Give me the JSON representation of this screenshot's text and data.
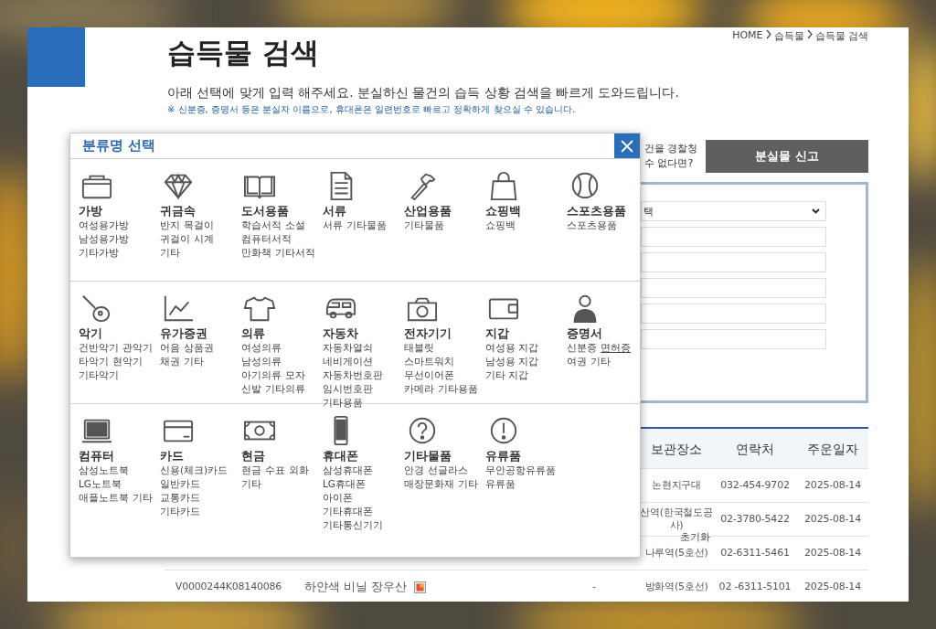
{
  "breadcrumb": [
    "HOME",
    "습득물",
    "습득물 검색"
  ],
  "title": "습득물 검색",
  "description": "아래 선택에 맞게 입력 해주세요. 분실하신 물건의 습득 상황 검색을 빠르게 도와드립니다.",
  "note": "※ 신분증, 증명서 등은 분실자 이름으로, 휴대폰은 일련번호로 빠르고 정확하게 찾으실 수 있습니다.",
  "report": {
    "prompt_lines": [
      "건을 경찰청",
      "수 없다면?"
    ],
    "button": "분실물 신고"
  },
  "search_form": {
    "select_value": "택",
    "reset_label": "초기화"
  },
  "table": {
    "columns": [
      "보관장소",
      "연락처",
      "주운일자"
    ],
    "rows": [
      {
        "location": "논현지구대",
        "phone": "032-454-9702",
        "date": "2025-08-14"
      },
      {
        "location": "산역(한국철도공사)",
        "phone": "02-3780-5422",
        "date": "2025-08-14"
      },
      {
        "location": "나루역(5호선)",
        "phone": "02-6311-5461",
        "date": "2025-08-14"
      },
      {
        "id": "V0000244K08140086",
        "name": "하얀색 비닐 장우산",
        "has_image": true,
        "status": "-",
        "location": "방화역(5호선)",
        "phone": "02 -6311-5101",
        "date": "2025-08-14"
      }
    ]
  },
  "modal": {
    "title": "분류명 선택",
    "sections": [
      [
        {
          "name": "가방",
          "lines": [
            [
              "여성용가방"
            ],
            [
              "남성용가방"
            ],
            [
              "기타가방"
            ]
          ]
        },
        {
          "name": "귀금속",
          "lines": [
            [
              "반지",
              "목걸이"
            ],
            [
              "귀걸이",
              "시계"
            ],
            [
              "기타"
            ]
          ]
        },
        {
          "name": "도서용품",
          "lines": [
            [
              "학습서적",
              "소설"
            ],
            [
              "컴퓨터서적"
            ],
            [
              "만화책",
              "기타서적"
            ]
          ]
        },
        {
          "name": "서류",
          "lines": [
            [
              "서류",
              "기타물품"
            ]
          ]
        },
        {
          "name": "산업용품",
          "lines": [
            [
              "기타물품"
            ]
          ]
        },
        {
          "name": "쇼핑백",
          "lines": [
            [
              "쇼핑백"
            ]
          ]
        },
        {
          "name": "스포츠용품",
          "lines": [
            [
              "스포츠용품"
            ]
          ]
        }
      ],
      [
        {
          "name": "악기",
          "lines": [
            [
              "건반악기",
              "관악기"
            ],
            [
              "타악기",
              "현악기"
            ],
            [
              "기타악기"
            ]
          ]
        },
        {
          "name": "유가증권",
          "lines": [
            [
              "어음",
              "상품권"
            ],
            [
              "채권",
              "기타"
            ]
          ]
        },
        {
          "name": "의류",
          "lines": [
            [
              "여성의류"
            ],
            [
              "남성의류"
            ],
            [
              "아기의류",
              "모자"
            ],
            [
              "신발",
              "기타의류"
            ]
          ]
        },
        {
          "name": "자동차",
          "lines": [
            [
              "자동차열쇠"
            ],
            [
              "네비게이션"
            ],
            [
              "자동차번호판"
            ],
            [
              "임시번호판"
            ],
            [
              "기타용품"
            ]
          ]
        },
        {
          "name": "전자기기",
          "lines": [
            [
              "태블릿"
            ],
            [
              "스마트워치"
            ],
            [
              "무선이어폰"
            ],
            [
              "카메라",
              "기타용품"
            ]
          ]
        },
        {
          "name": "지갑",
          "lines": [
            [
              "여성용 지갑"
            ],
            [
              "남성용 지갑"
            ],
            [
              "기타 지갑"
            ]
          ]
        },
        {
          "name": "증명서",
          "lines": [
            [
              "신분증",
              {
                "label": "면허증",
                "hovered": true
              }
            ],
            [
              "여권",
              "기타"
            ]
          ]
        }
      ],
      [
        {
          "name": "컴퓨터",
          "lines": [
            [
              "삼성노트북"
            ],
            [
              "LG노트북"
            ],
            [
              "애플노트북",
              "기타"
            ]
          ]
        },
        {
          "name": "카드",
          "lines": [
            [
              "신용(체크)카드"
            ],
            [
              "일반카드"
            ],
            [
              "교통카드"
            ],
            [
              "기타카드"
            ]
          ]
        },
        {
          "name": "현금",
          "lines": [
            [
              "현금",
              "수표",
              "외화"
            ],
            [
              "기타"
            ]
          ]
        },
        {
          "name": "휴대폰",
          "lines": [
            [
              "삼성휴대폰"
            ],
            [
              "LG휴대폰"
            ],
            [
              "아이폰"
            ],
            [
              "기타휴대폰"
            ],
            [
              "기타통신기기"
            ]
          ]
        },
        {
          "name": "기타물품",
          "lines": [
            [
              "안경",
              "선글라스"
            ],
            [
              "매장문화재",
              "기타"
            ]
          ]
        },
        {
          "name": "유류품",
          "lines": [
            [
              "무안공항유류품"
            ],
            [
              "유류품"
            ]
          ]
        }
      ]
    ]
  }
}
